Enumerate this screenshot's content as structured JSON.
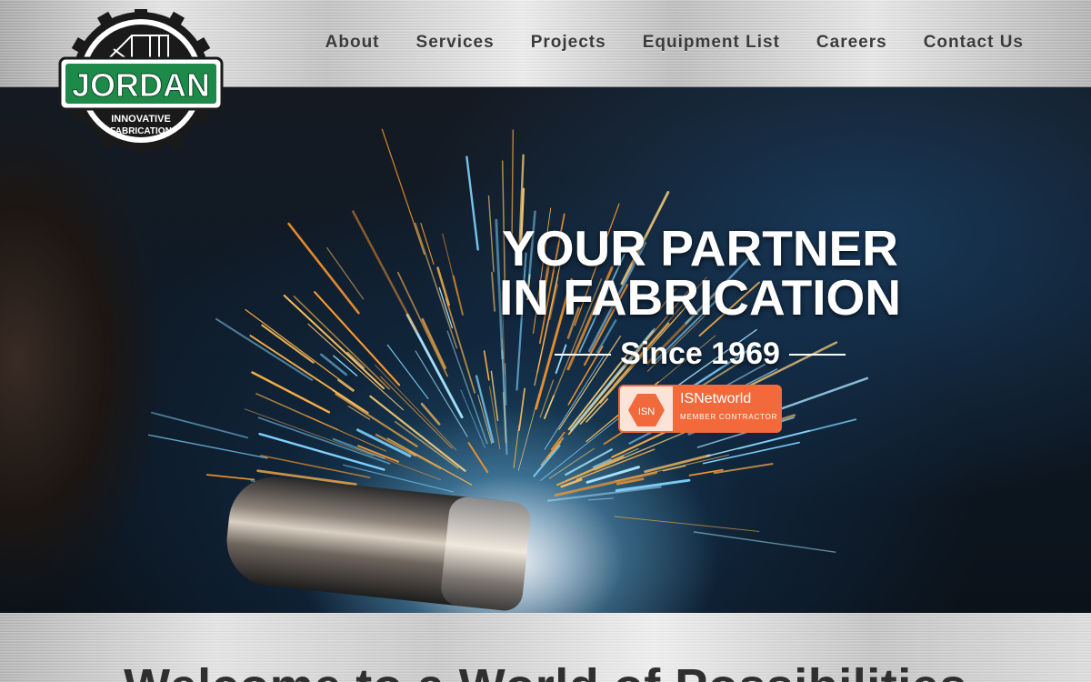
{
  "logo": {
    "name": "JORDAN",
    "tagline_1": "INNOVATIVE",
    "tagline_2": "FABRICATION"
  },
  "nav": [
    {
      "label": "About"
    },
    {
      "label": "Services"
    },
    {
      "label": "Projects"
    },
    {
      "label": "Equipment List"
    },
    {
      "label": "Careers"
    },
    {
      "label": "Contact Us"
    }
  ],
  "hero": {
    "title_line_1": "YOUR PARTNER",
    "title_line_2": "IN FABRICATION",
    "since": "Since 1969",
    "badge": {
      "logo_text": "ISN",
      "name": "ISNetworld",
      "subtitle": "MEMBER CONTRACTOR"
    }
  },
  "welcome": {
    "title": "Welcome to a World of Possibilities"
  },
  "colors": {
    "brand_green": "#1e8a4a",
    "badge_orange": "#f26a3b",
    "nav_text": "#3a3a3a"
  }
}
